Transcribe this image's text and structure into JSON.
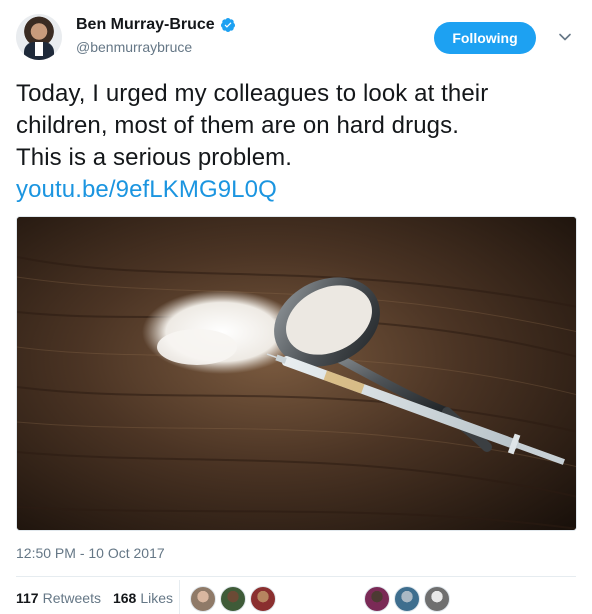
{
  "user": {
    "display_name": "Ben Murray-Bruce",
    "handle": "@benmurraybruce",
    "verified": true
  },
  "follow_button": {
    "label": "Following"
  },
  "tweet": {
    "lines": [
      "Today, I urged my colleagues to look at their",
      "children, most of them are on hard drugs.",
      "This is a serious problem."
    ],
    "link": "youtu.be/9efLKMG9L0Q"
  },
  "timestamp": "12:50 PM - 10 Oct 2017",
  "stats": {
    "retweets_count": "117",
    "retweets_label": "Retweets",
    "likes_count": "168",
    "likes_label": "Likes"
  },
  "icons": {
    "verified": "verified-badge-icon",
    "caret": "chevron-down-icon"
  },
  "colors": {
    "accent": "#1da1f2",
    "link": "#1b95e0",
    "muted": "#657786"
  }
}
